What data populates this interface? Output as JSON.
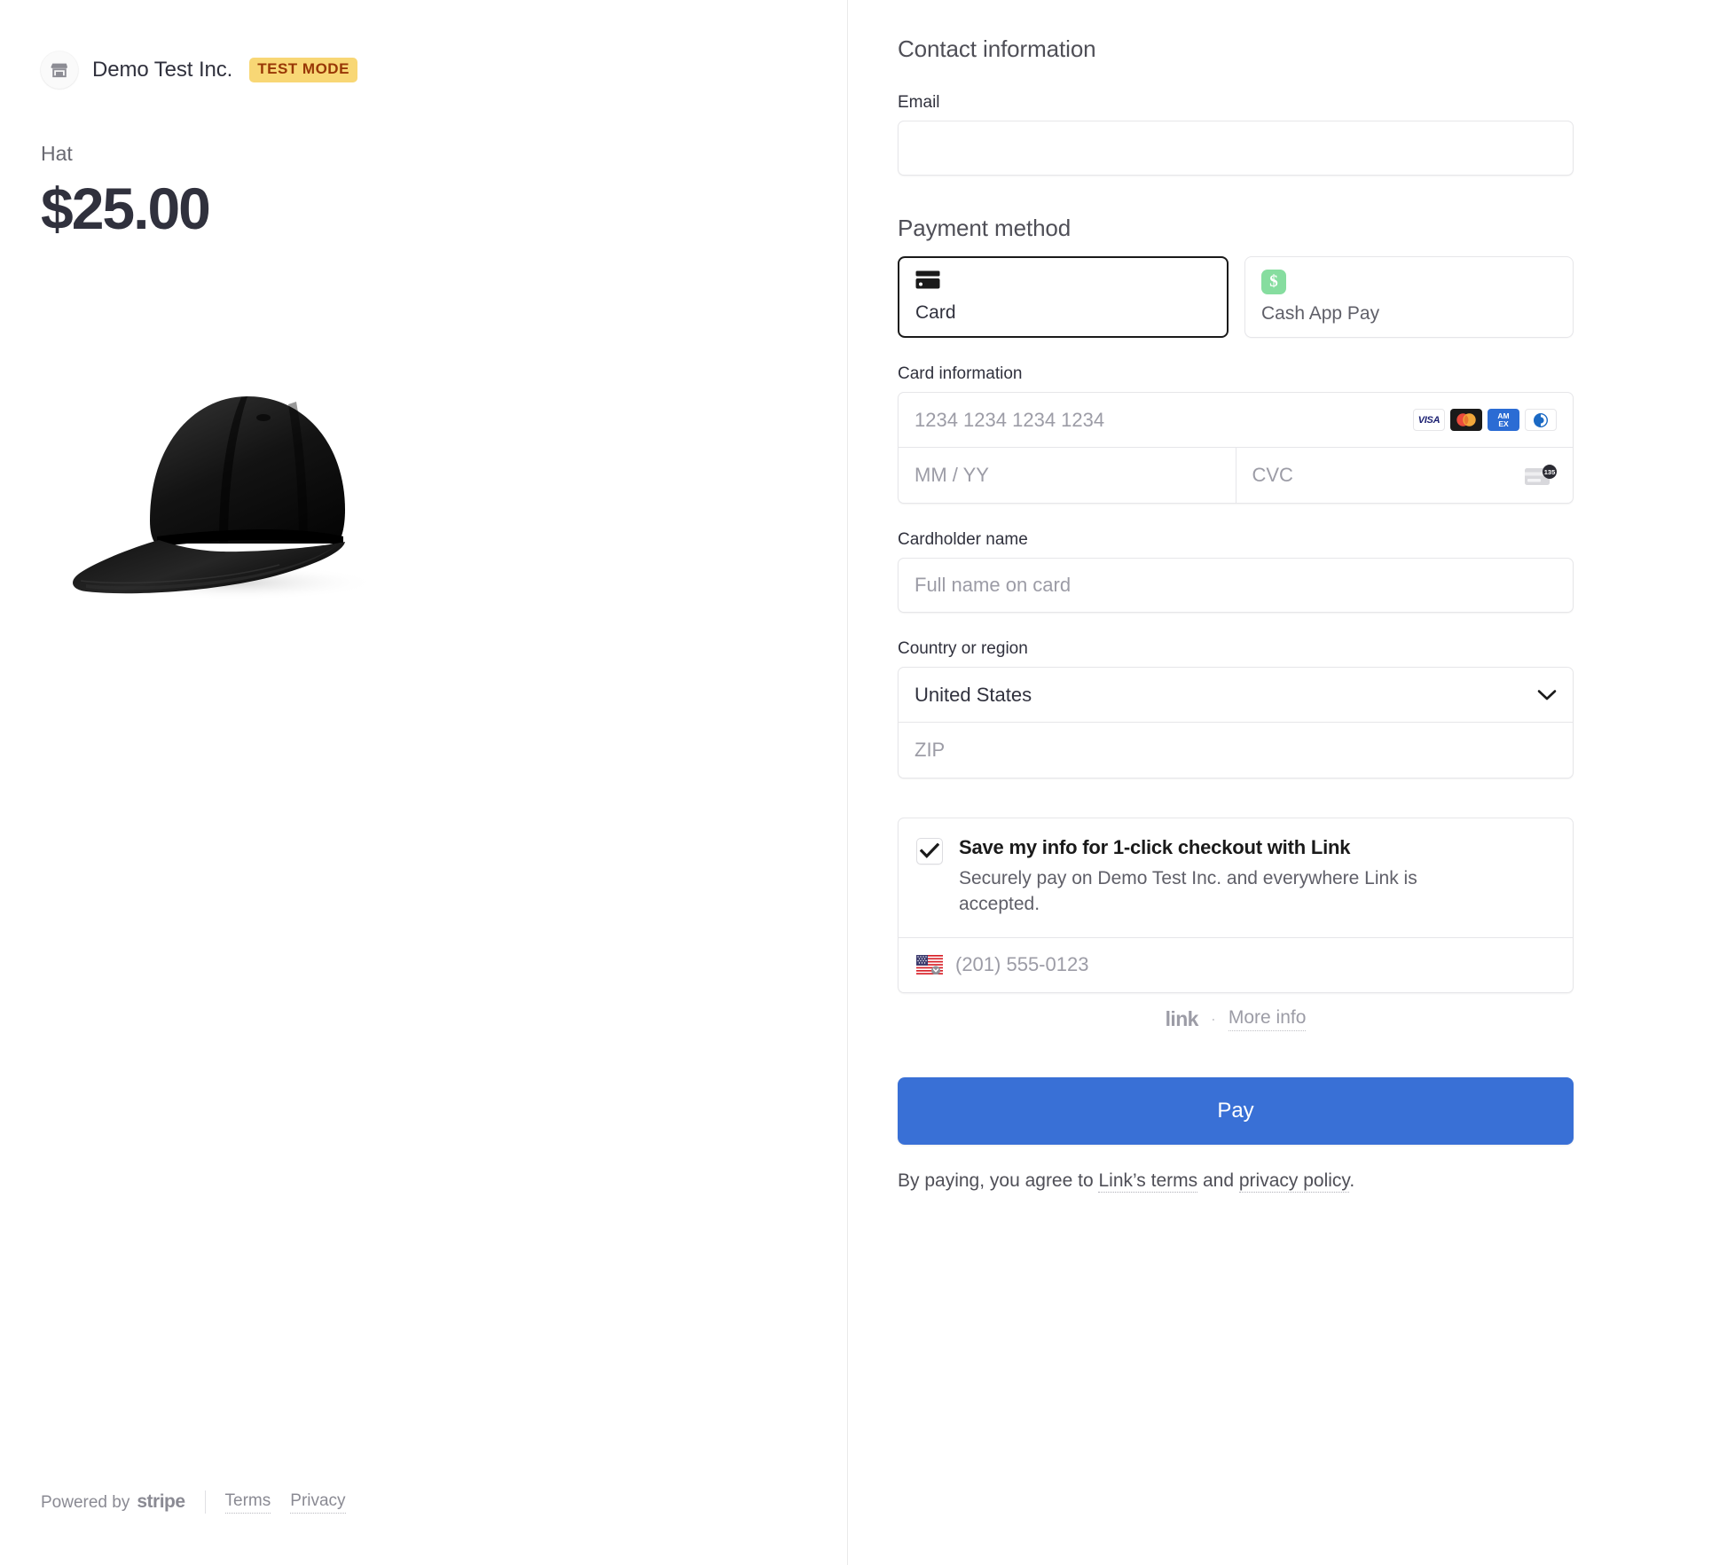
{
  "merchant": {
    "name": "Demo Test Inc.",
    "badge": "TEST MODE",
    "store_icon": "store-icon"
  },
  "product": {
    "label": "Hat",
    "price": "$25.00",
    "image_alt": "black baseball cap"
  },
  "footer": {
    "powered_by": "Powered by",
    "stripe": "stripe",
    "terms": "Terms",
    "privacy": "Privacy"
  },
  "contact": {
    "section_title": "Contact information",
    "email_label": "Email",
    "email_value": "",
    "email_placeholder": ""
  },
  "payment": {
    "section_title": "Payment method",
    "tabs": [
      {
        "label": "Card",
        "icon": "credit-card-icon",
        "selected": true
      },
      {
        "label": "Cash App Pay",
        "icon": "cash-app-icon",
        "selected": false
      }
    ],
    "card_info_label": "Card information",
    "card_number_placeholder": "1234 1234 1234 1234",
    "expiry_placeholder": "MM / YY",
    "cvc_placeholder": "CVC",
    "cvc_icon_digits": "135",
    "brands": [
      "VISA",
      "mastercard",
      "AMEX",
      "diners-club"
    ],
    "cardholder_label": "Cardholder name",
    "cardholder_placeholder": "Full name on card",
    "country_label": "Country or region",
    "country_value": "United States",
    "zip_placeholder": "ZIP"
  },
  "link": {
    "checkbox_checked": true,
    "title": "Save my info for 1-click checkout with Link",
    "subtitle": "Securely pay on Demo Test Inc. and everywhere Link is accepted.",
    "phone_placeholder": "(201) 555-0123",
    "country_flag": "us-flag-icon",
    "wordmark": "link",
    "separator": "·",
    "more_info": "More info"
  },
  "pay": {
    "button_label": "Pay",
    "terms_prefix": "By paying, you agree to ",
    "terms_link": "Link’s terms",
    "terms_middle": " and ",
    "privacy_link": "privacy policy",
    "terms_suffix": "."
  },
  "colors": {
    "pay_button": "#3970d6",
    "test_badge_bg": "#f8d775",
    "test_badge_text": "#983705",
    "cashapp_green": "#86dd9f",
    "text_primary": "#30313d",
    "text_muted": "#6a6a72"
  }
}
